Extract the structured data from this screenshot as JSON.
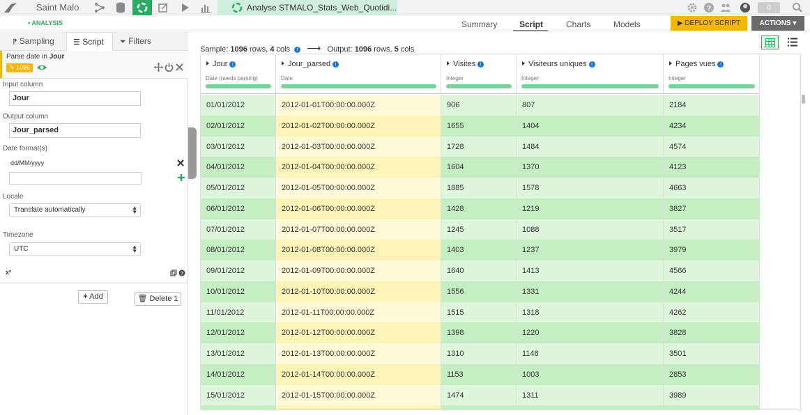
{
  "topbar": {
    "project_name": "Saint Malo",
    "tab_title": "Analyse STMALO_Stats_Web_Quotidi...",
    "notification_count": "0"
  },
  "secbar": {
    "analysis_label": "• ANALYSIS",
    "tabs": [
      "Summary",
      "Script",
      "Charts",
      "Models"
    ],
    "active_tab": "Script",
    "deploy_label": "DEPLOY SCRIPT",
    "actions_label": "ACTIONS"
  },
  "left": {
    "tabs": [
      "Sampling",
      "Script",
      "Filters"
    ],
    "step": {
      "title_prefix": "Parse date in ",
      "title_column": "Jour",
      "badge": "1096"
    },
    "input_column_label": "Input column",
    "input_column_value": "Jour",
    "output_column_label": "Output column",
    "output_column_value": "Jour_parsed",
    "date_formats_label": "Date format(s)",
    "date_format_value": "dd/MM/yyyy",
    "locale_label": "Locale",
    "locale_value": "Translate automatically",
    "timezone_label": "Timezone",
    "timezone_value": "UTC",
    "x2_label": "x²",
    "add_label": "Add",
    "delete_label": "Delete 1"
  },
  "sample": {
    "prefix": "Sample: ",
    "rows": "1096",
    "rows_word": " rows, ",
    "cols": "4",
    "cols_word": " cols",
    "output_prefix": "Output: ",
    "out_rows": "1096",
    "out_cols": "5"
  },
  "grid": {
    "columns": [
      {
        "name": "Jour",
        "meaning": "Date (needs parsing)"
      },
      {
        "name": "Jour_parsed",
        "meaning": "Date"
      },
      {
        "name": "Visites",
        "meaning": "Integer"
      },
      {
        "name": "Visiteurs uniques",
        "meaning": "Integer"
      },
      {
        "name": "Pages vues",
        "meaning": "Integer"
      }
    ],
    "rows": [
      [
        "01/01/2012",
        "2012-01-01T00:00:00.000Z",
        "906",
        "807",
        "2184"
      ],
      [
        "02/01/2012",
        "2012-01-02T00:00:00.000Z",
        "1655",
        "1404",
        "4234"
      ],
      [
        "03/01/2012",
        "2012-01-03T00:00:00.000Z",
        "1728",
        "1484",
        "4574"
      ],
      [
        "04/01/2012",
        "2012-01-04T00:00:00.000Z",
        "1604",
        "1370",
        "4123"
      ],
      [
        "05/01/2012",
        "2012-01-05T00:00:00.000Z",
        "1885",
        "1578",
        "4663"
      ],
      [
        "06/01/2012",
        "2012-01-06T00:00:00.000Z",
        "1428",
        "1219",
        "3827"
      ],
      [
        "07/01/2012",
        "2012-01-07T00:00:00.000Z",
        "1245",
        "1088",
        "3517"
      ],
      [
        "08/01/2012",
        "2012-01-08T00:00:00.000Z",
        "1403",
        "1237",
        "3979"
      ],
      [
        "09/01/2012",
        "2012-01-09T00:00:00.000Z",
        "1640",
        "1413",
        "4566"
      ],
      [
        "10/01/2012",
        "2012-01-10T00:00:00.000Z",
        "1556",
        "1331",
        "4244"
      ],
      [
        "11/01/2012",
        "2012-01-11T00:00:00.000Z",
        "1515",
        "1318",
        "4262"
      ],
      [
        "12/01/2012",
        "2012-01-12T00:00:00.000Z",
        "1398",
        "1220",
        "3828"
      ],
      [
        "13/01/2012",
        "2012-01-13T00:00:00.000Z",
        "1310",
        "1148",
        "3501"
      ],
      [
        "14/01/2012",
        "2012-01-14T00:00:00.000Z",
        "1153",
        "1003",
        "2853"
      ],
      [
        "15/01/2012",
        "2012-01-15T00:00:00.000Z",
        "1474",
        "1311",
        "3989"
      ],
      [
        "",
        "",
        "",
        "",
        ""
      ]
    ]
  },
  "colors": {
    "accent_green": "#2aab63",
    "deploy_yellow": "#f5b800",
    "row_green_light": "#ddf7dd",
    "row_green_dark": "#c5efc3",
    "row_yellow_light": "#fffbd6",
    "row_yellow_dark": "#fff4b8"
  }
}
